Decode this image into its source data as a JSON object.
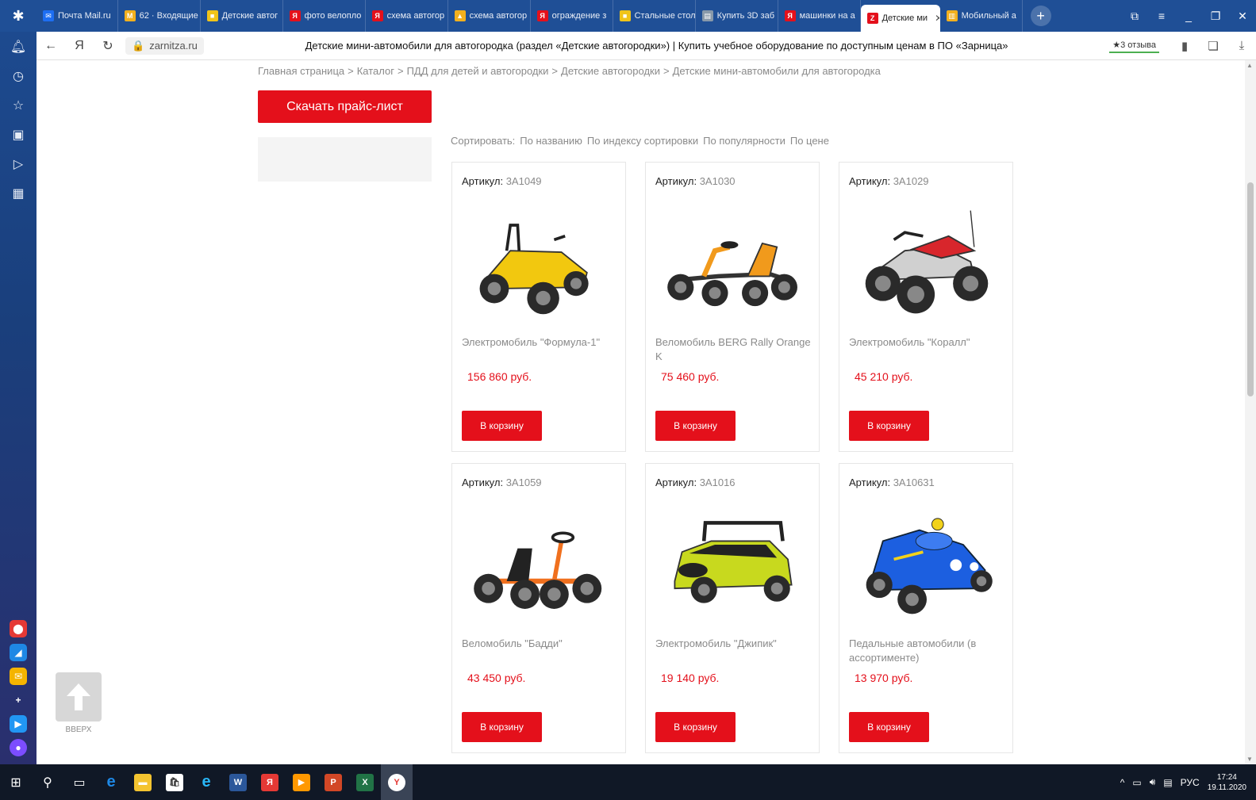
{
  "browser": {
    "tabs": [
      {
        "label": "Почта Mail.ru",
        "color": "#1d6ef2",
        "glyph": "✉"
      },
      {
        "label": "62 · Входящие",
        "color": "#f2b01e",
        "glyph": "M"
      },
      {
        "label": "Детские автог",
        "color": "#f0c419",
        "glyph": "■"
      },
      {
        "label": "фото велопло",
        "color": "#e4101b",
        "glyph": "Я"
      },
      {
        "label": "схема автогор",
        "color": "#e4101b",
        "glyph": "Я"
      },
      {
        "label": "схема автогор",
        "color": "#f2b01e",
        "glyph": "▲"
      },
      {
        "label": "ограждение з",
        "color": "#e4101b",
        "glyph": "Я"
      },
      {
        "label": "Стальные стол",
        "color": "#f0c419",
        "glyph": "■"
      },
      {
        "label": "Купить 3D заб",
        "color": "#8899aa",
        "glyph": "▤"
      },
      {
        "label": "машинки на а",
        "color": "#e4101b",
        "glyph": "Я"
      },
      {
        "label": "Детские ми",
        "color": "#e4101b",
        "glyph": "Z",
        "active": true
      },
      {
        "label": "Мобильный а",
        "color": "#f2b01e",
        "glyph": "▥"
      }
    ],
    "domain": "zarnitza.ru",
    "page_title": "Детские мини-автомобили для автогородка (раздел «Детские автогородки») | Купить учебное оборудование по доступным ценам в ПО «Зарница»",
    "reviews": "★3 отзыва"
  },
  "breadcrumb": [
    "Главная страница",
    "Каталог",
    "ПДД для детей и автогородки",
    "Детские автогородки",
    "Детские мини-автомобили для автогородка"
  ],
  "price_list_button": "Скачать прайс-лист",
  "sort": {
    "label": "Сортировать:",
    "options": [
      "По названию",
      "По индексу сортировки",
      "По популярности",
      "По цене"
    ]
  },
  "sku_label": "Артикул:",
  "cart_label": "В корзину",
  "products": [
    {
      "sku": "3А1049",
      "name": "Электромобиль \"Формула-1\"",
      "price": "156 860 руб.",
      "image": "yellow-buggy",
      "color": "#f2c80f"
    },
    {
      "sku": "3А1030",
      "name": "Веломобиль BERG Rally Orange K",
      "price": "75 460 руб.",
      "image": "orange-kart",
      "color": "#f19a1c"
    },
    {
      "sku": "3А1029",
      "name": "Электромобиль \"Коралл\"",
      "price": "45 210 руб.",
      "image": "red-quad",
      "color": "#d8262c"
    },
    {
      "sku": "3А1059",
      "name": "Веломобиль \"Бадди\"",
      "price": "43 450 руб.",
      "image": "orange-pedal-kart",
      "color": "#f0701e"
    },
    {
      "sku": "3А1016",
      "name": "Электромобиль \"Джипик\"",
      "price": "19 140 руб.",
      "image": "lime-car",
      "color": "#c8d91e"
    },
    {
      "sku": "3А10631",
      "name": "Педальные автомобили (в ассортименте)",
      "price": "13 970 руб.",
      "image": "blue-pedal-car",
      "color": "#1c5fe0"
    }
  ],
  "to_top_label": "ВВЕРХ",
  "taskbar": {
    "lang": "РУС",
    "time": "17:24",
    "date": "19.11.2020"
  },
  "colors": {
    "accent": "#e4101b",
    "browser_blue": "#1f4f96"
  }
}
